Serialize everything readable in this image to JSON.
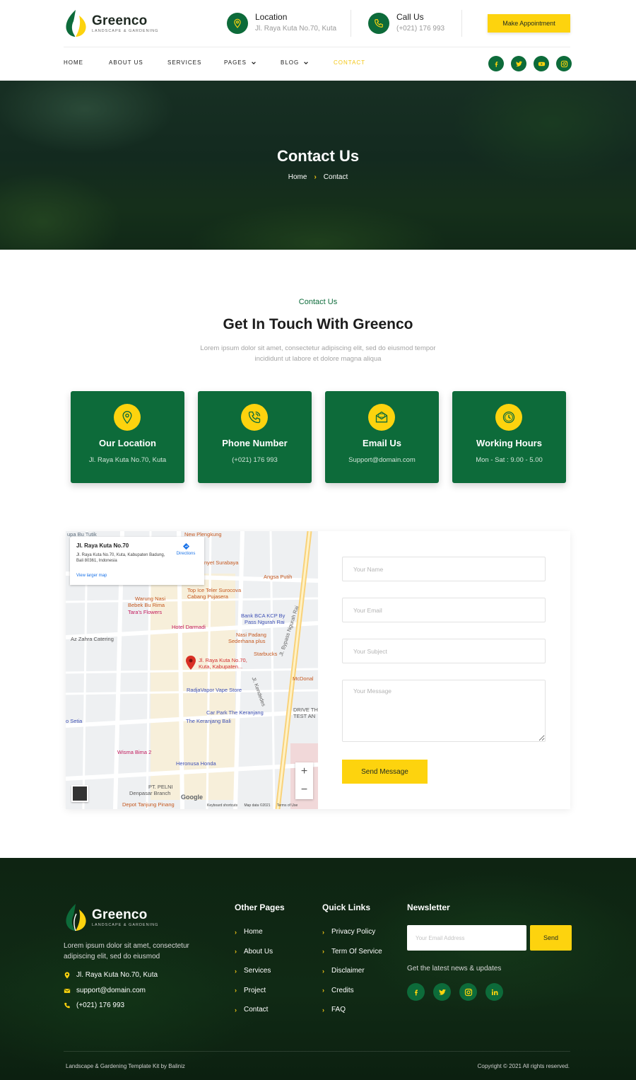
{
  "brand": {
    "name": "Greenco",
    "tagline": "LANDSCAPE & GARDENING"
  },
  "header": {
    "location": {
      "title": "Location",
      "value": "Jl. Raya Kuta No.70, Kuta"
    },
    "call": {
      "title": "Call Us",
      "value": "(+021) 176 993"
    },
    "appointment_label": "Make Appointment"
  },
  "nav": {
    "items": [
      {
        "label": "HOME"
      },
      {
        "label": "ABOUT US"
      },
      {
        "label": "SERVICES"
      },
      {
        "label": "PAGES"
      },
      {
        "label": "BLOG"
      },
      {
        "label": "CONTACT"
      }
    ],
    "active_index": 5,
    "socials": [
      "facebook-icon",
      "twitter-icon",
      "youtube-icon",
      "instagram-icon"
    ]
  },
  "hero": {
    "title": "Contact Us",
    "breadcrumb": {
      "home": "Home",
      "separator": "›",
      "current": "Contact"
    }
  },
  "intro": {
    "tag": "Contact Us",
    "title": "Get In Touch With Greenco",
    "description": "Lorem ipsum dolor sit amet, consectetur adipiscing elit, sed do eiusmod tempor incididunt ut labore et dolore magna aliqua"
  },
  "cards": [
    {
      "icon": "map-pin-icon",
      "title": "Our Location",
      "value": "Jl. Raya Kuta No.70, Kuta"
    },
    {
      "icon": "phone-icon",
      "title": "Phone Number",
      "value": "(+021) 176 993"
    },
    {
      "icon": "envelope-icon",
      "title": "Email Us",
      "value": "Support@domain.com"
    },
    {
      "icon": "clock-icon",
      "title": "Working Hours",
      "value": "Mon - Sat : 9.00 - 5.00"
    }
  ],
  "map": {
    "info_title": "Jl. Raya Kuta No.70",
    "info_address": "Jl. Raya Kuta No.70, Kuta, Kabupaten Badung, Bali 80361, Indonesia",
    "directions": "Directions",
    "larger_map": "View larger map",
    "labels": {
      "l1": "upa Bu Tutik",
      "l2": "New Plengkung",
      "l3": "nyet Surabaya",
      "l4": "Angsa Putih",
      "l5": "Top Ice Teler Surocova",
      "l6": "Cabang Pujasera",
      "l7": "Warung Nasi",
      "l8": "Bebek Bu Rima",
      "l9": "Tara's Flowers",
      "l10": "Hotel Darmadi",
      "l11": "Bank BCA KCP By",
      "l12": "Pass Ngurah Rai",
      "l13": "Az Zahra Catering",
      "l14": "Nasi Padang",
      "l15": "Sederhana plus",
      "l16": "Starbucks",
      "l17": "Jl. Raya Kuta No.70,",
      "l18": "Kuta, Kabupaten...",
      "l19": "Jl. Bypass Ngurah Rai",
      "l20": "McDonal",
      "l21": "RadjaVapor Vape Store",
      "l22": "Jl. Kendedes",
      "l23": "Car Park The Keranjang",
      "l24": "The Keranjang Bali",
      "l25": "DRIVE TH",
      "l26": "TEST AN",
      "l27": "o Setia",
      "l28": "Wisma Bima 2",
      "l29": "Heronusa Honda",
      "l30": "PT. PELNI",
      "l31": "Denpasar Branch",
      "l32": "Depot Tanjung Pinang"
    },
    "zoom_in": "+",
    "zoom_out": "−",
    "google": "Google",
    "footer_keyboard": "Keyboard shortcuts",
    "footer_mapdata": "Map data ©2021",
    "footer_terms": "Terms of Use"
  },
  "form": {
    "name_placeholder": "Your Name",
    "email_placeholder": "Your Email",
    "subject_placeholder": "Your Subject",
    "message_placeholder": "Your Message",
    "send_label": "Send Message"
  },
  "footer": {
    "description": "Lorem ipsum dolor sit amet, consectetur adipiscing elit, sed do eiusmod",
    "address": "Jl. Raya Kuta No.70, Kuta",
    "email": "support@domain.com",
    "phone": "(+021) 176 993",
    "other_pages": {
      "title": "Other Pages",
      "links": [
        "Home",
        "About Us",
        "Services",
        "Project",
        "Contact"
      ]
    },
    "quick_links": {
      "title": "Quick Links",
      "links": [
        "Privacy Policy",
        "Term Of Service",
        "Disclaimer",
        "Credits",
        "FAQ"
      ]
    },
    "newsletter": {
      "title": "Newsletter",
      "placeholder": "Your Email Address",
      "button": "Send",
      "note": "Get the latest news & updates"
    },
    "socials": [
      "facebook-icon",
      "twitter-icon",
      "instagram-icon",
      "linkedin-icon"
    ],
    "copyright_left": "Landscape & Gardening Template Kit by Baliniz",
    "copyright_right": "Copyright © 2021 All rights reserved."
  },
  "colors": {
    "primary_green": "#0d6b3a",
    "accent_yellow": "#fdd30e",
    "dark_footer": "#0e2412"
  }
}
